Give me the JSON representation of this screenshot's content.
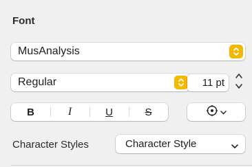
{
  "font_section": {
    "title": "Font",
    "family": "MusAnalysis",
    "style": "Regular",
    "size": "11 pt"
  },
  "format_buttons": {
    "bold": "B",
    "italic": "I",
    "underline": "U",
    "strikethrough": "S"
  },
  "character_styles": {
    "label": "Character Styles",
    "value": "Character Style"
  },
  "colors": {
    "accent": "#f5b800",
    "panel_bg": "#f0f0f0"
  },
  "icons": [
    "popup-chevrons-icon",
    "stepper-arrows-icon",
    "gear-options-icon",
    "chevron-down-icon"
  ]
}
